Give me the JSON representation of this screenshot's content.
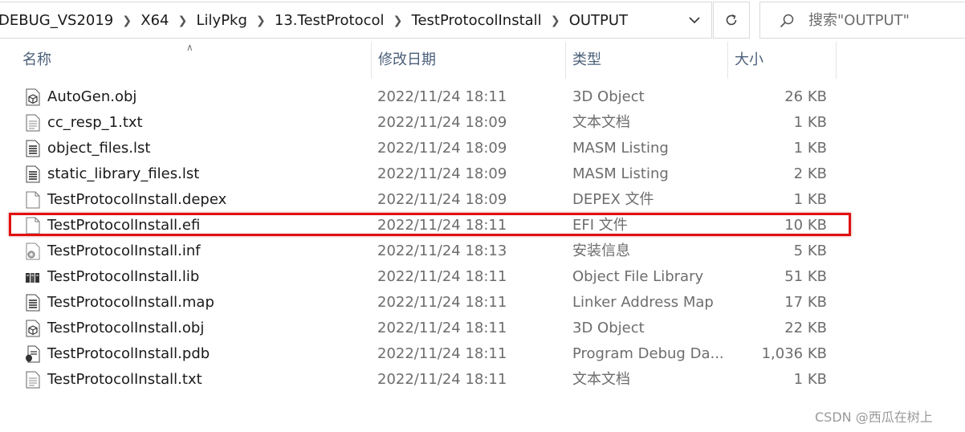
{
  "address": {
    "crumbs": [
      "DEBUG_VS2019",
      "X64",
      "LilyPkg",
      "13.TestProtocol",
      "TestProtocolInstall",
      "OUTPUT"
    ]
  },
  "search": {
    "placeholder": "搜索\"OUTPUT\""
  },
  "columns": {
    "name": "名称",
    "modified": "修改日期",
    "type": "类型",
    "size": "大小"
  },
  "files": [
    {
      "name": "AutoGen.obj",
      "modified": "2022/11/24 18:11",
      "type": "3D Object",
      "size": "26 KB",
      "icon": "3d-object-icon"
    },
    {
      "name": "cc_resp_1.txt",
      "modified": "2022/11/24 18:09",
      "type": "文本文档",
      "size": "1 KB",
      "icon": "text-file-icon"
    },
    {
      "name": "object_files.lst",
      "modified": "2022/11/24 18:09",
      "type": "MASM Listing",
      "size": "1 KB",
      "icon": "listing-file-icon"
    },
    {
      "name": "static_library_files.lst",
      "modified": "2022/11/24 18:09",
      "type": "MASM Listing",
      "size": "2 KB",
      "icon": "listing-file-icon"
    },
    {
      "name": "TestProtocolInstall.depex",
      "modified": "2022/11/24 18:09",
      "type": "DEPEX 文件",
      "size": "1 KB",
      "icon": "blank-file-icon"
    },
    {
      "name": "TestProtocolInstall.efi",
      "modified": "2022/11/24 18:11",
      "type": "EFI 文件",
      "size": "10 KB",
      "icon": "blank-file-icon"
    },
    {
      "name": "TestProtocolInstall.inf",
      "modified": "2022/11/24 18:13",
      "type": "安装信息",
      "size": "5 KB",
      "icon": "setup-info-icon"
    },
    {
      "name": "TestProtocolInstall.lib",
      "modified": "2022/11/24 18:11",
      "type": "Object File Library",
      "size": "51 KB",
      "icon": "library-file-icon"
    },
    {
      "name": "TestProtocolInstall.map",
      "modified": "2022/11/24 18:11",
      "type": "Linker Address Map",
      "size": "17 KB",
      "icon": "listing-file-icon"
    },
    {
      "name": "TestProtocolInstall.obj",
      "modified": "2022/11/24 18:11",
      "type": "3D Object",
      "size": "22 KB",
      "icon": "3d-object-icon"
    },
    {
      "name": "TestProtocolInstall.pdb",
      "modified": "2022/11/24 18:11",
      "type": "Program Debug Da...",
      "size": "1,036 KB",
      "icon": "debug-db-icon"
    },
    {
      "name": "TestProtocolInstall.txt",
      "modified": "2022/11/24 18:11",
      "type": "文本文档",
      "size": "1 KB",
      "icon": "text-file-icon"
    }
  ],
  "highlighted_file": "TestProtocolInstall.efi",
  "highlight_color": "#e01010",
  "watermark": "CSDN @西瓜在树上"
}
